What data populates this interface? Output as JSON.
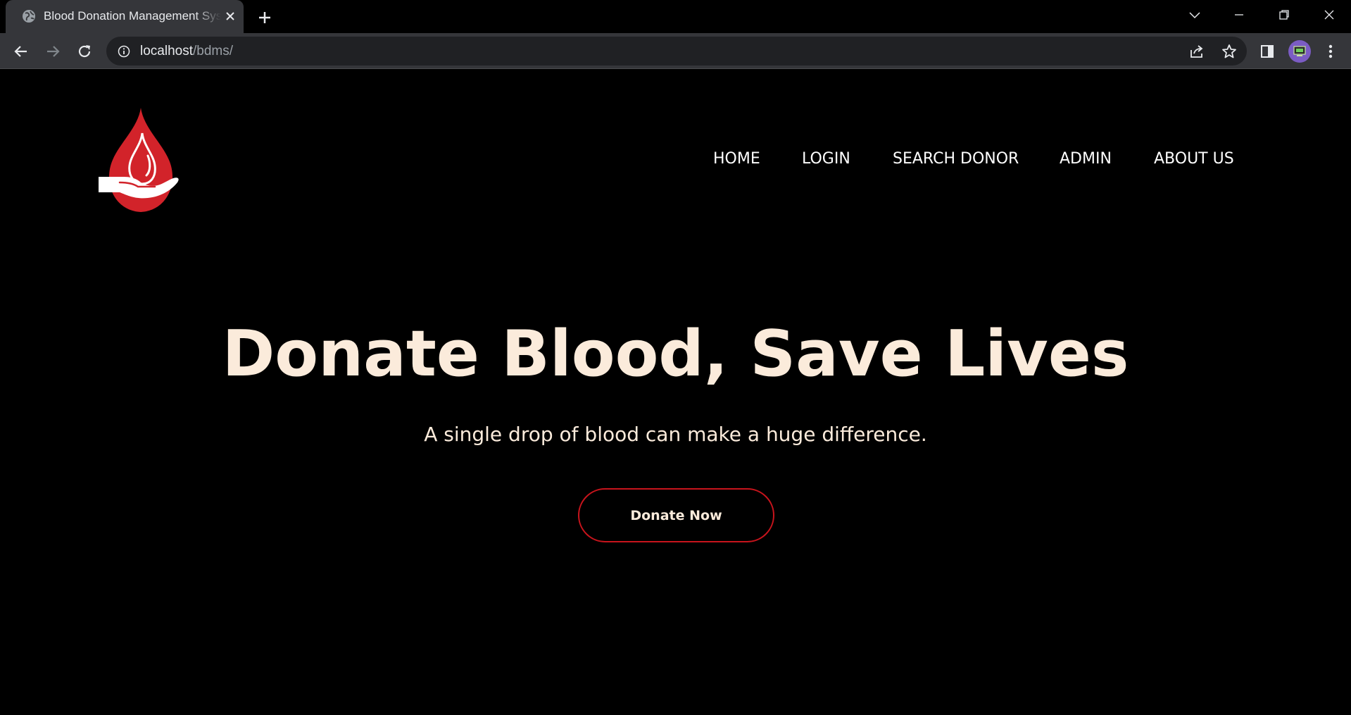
{
  "browser": {
    "tab_title": "Blood Donation Management System",
    "tab_favicon": "globe-icon",
    "url_host": "localhost",
    "url_path": "/bdms/",
    "colors": {
      "chrome": "#35363a",
      "omnibox": "#202124",
      "tabstrip": "#000000"
    }
  },
  "site": {
    "logo": "blood-drop-hand-logo",
    "nav": [
      {
        "label": "HOME"
      },
      {
        "label": "LOGIN"
      },
      {
        "label": "SEARCH DONOR"
      },
      {
        "label": "ADMIN"
      },
      {
        "label": "ABOUT US"
      }
    ],
    "hero": {
      "title": "Donate Blood, Save Lives",
      "subtitle": "A single drop of blood can make a huge difference.",
      "cta_label": "Donate Now"
    },
    "colors": {
      "accent": "#c8141c",
      "text": "#fbebdb",
      "background": "#000000"
    }
  }
}
